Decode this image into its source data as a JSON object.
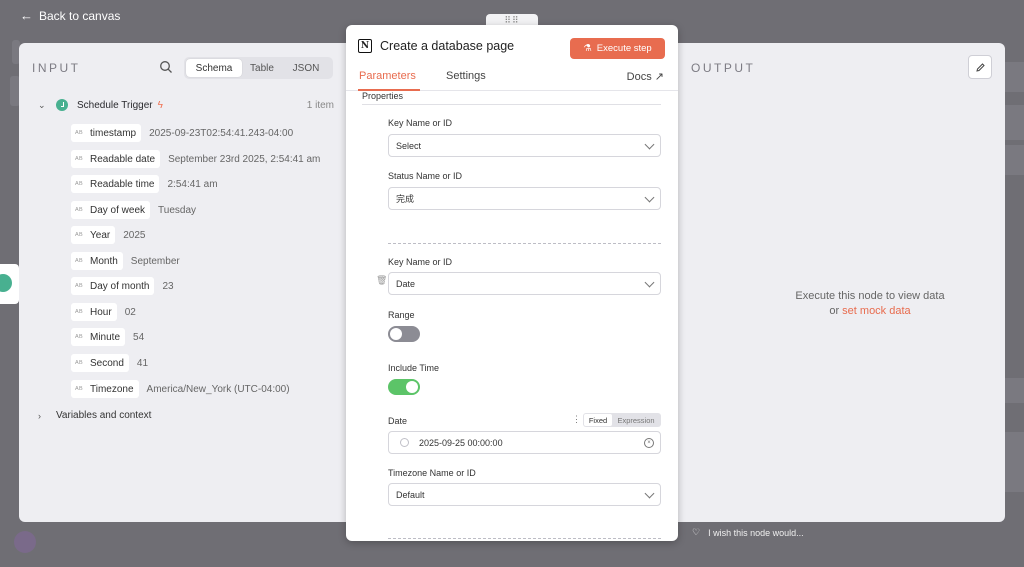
{
  "backdrop": {
    "back_label": "Back to canvas",
    "drag_handle": "⠿⠿"
  },
  "input": {
    "title": "INPUT",
    "view_tabs": [
      "Schema",
      "Table",
      "JSON"
    ],
    "trigger": {
      "name": "Schedule Trigger",
      "count": "1 item"
    },
    "fields": [
      {
        "name": "timestamp",
        "value": "2025-09-23T02:54:41.243-04:00"
      },
      {
        "name": "Readable date",
        "value": "September 23rd 2025, 2:54:41 am"
      },
      {
        "name": "Readable time",
        "value": "2:54:41 am"
      },
      {
        "name": "Day of week",
        "value": "Tuesday"
      },
      {
        "name": "Year",
        "value": "2025"
      },
      {
        "name": "Month",
        "value": "September"
      },
      {
        "name": "Day of month",
        "value": "23"
      },
      {
        "name": "Hour",
        "value": "02"
      },
      {
        "name": "Minute",
        "value": "54"
      },
      {
        "name": "Second",
        "value": "41"
      },
      {
        "name": "Timezone",
        "value": "America/New_York (UTC-04:00)"
      }
    ],
    "type_badge": "AB",
    "variables": "Variables and context"
  },
  "node": {
    "title": "Create a database page",
    "execute": "Execute step",
    "tabs": {
      "parameters": "Parameters",
      "settings": "Settings",
      "docs": "Docs"
    },
    "properties_label": "Properties",
    "prop1": {
      "key_label": "Key Name or ID",
      "key_value": "Select",
      "status_label": "Status Name or ID",
      "status_value": "完成"
    },
    "prop2": {
      "key_label": "Key Name or ID",
      "key_value": "Date",
      "range_label": "Range",
      "range_on": false,
      "include_time_label": "Include Time",
      "include_time_on": true,
      "date_label": "Date",
      "mode_fixed": "Fixed",
      "mode_expression": "Expression",
      "date_value": "2025-09-25 00:00:00",
      "tz_label": "Timezone Name or ID",
      "tz_value": "Default"
    }
  },
  "output": {
    "title": "OUTPUT",
    "message": "Execute this node to view data",
    "or": "or",
    "mock_link": "set mock data",
    "wish": "I wish this node would..."
  },
  "colors": {
    "accent": "#e86c4f",
    "toggle_on": "#5cc468",
    "trigger": "#48b090"
  }
}
